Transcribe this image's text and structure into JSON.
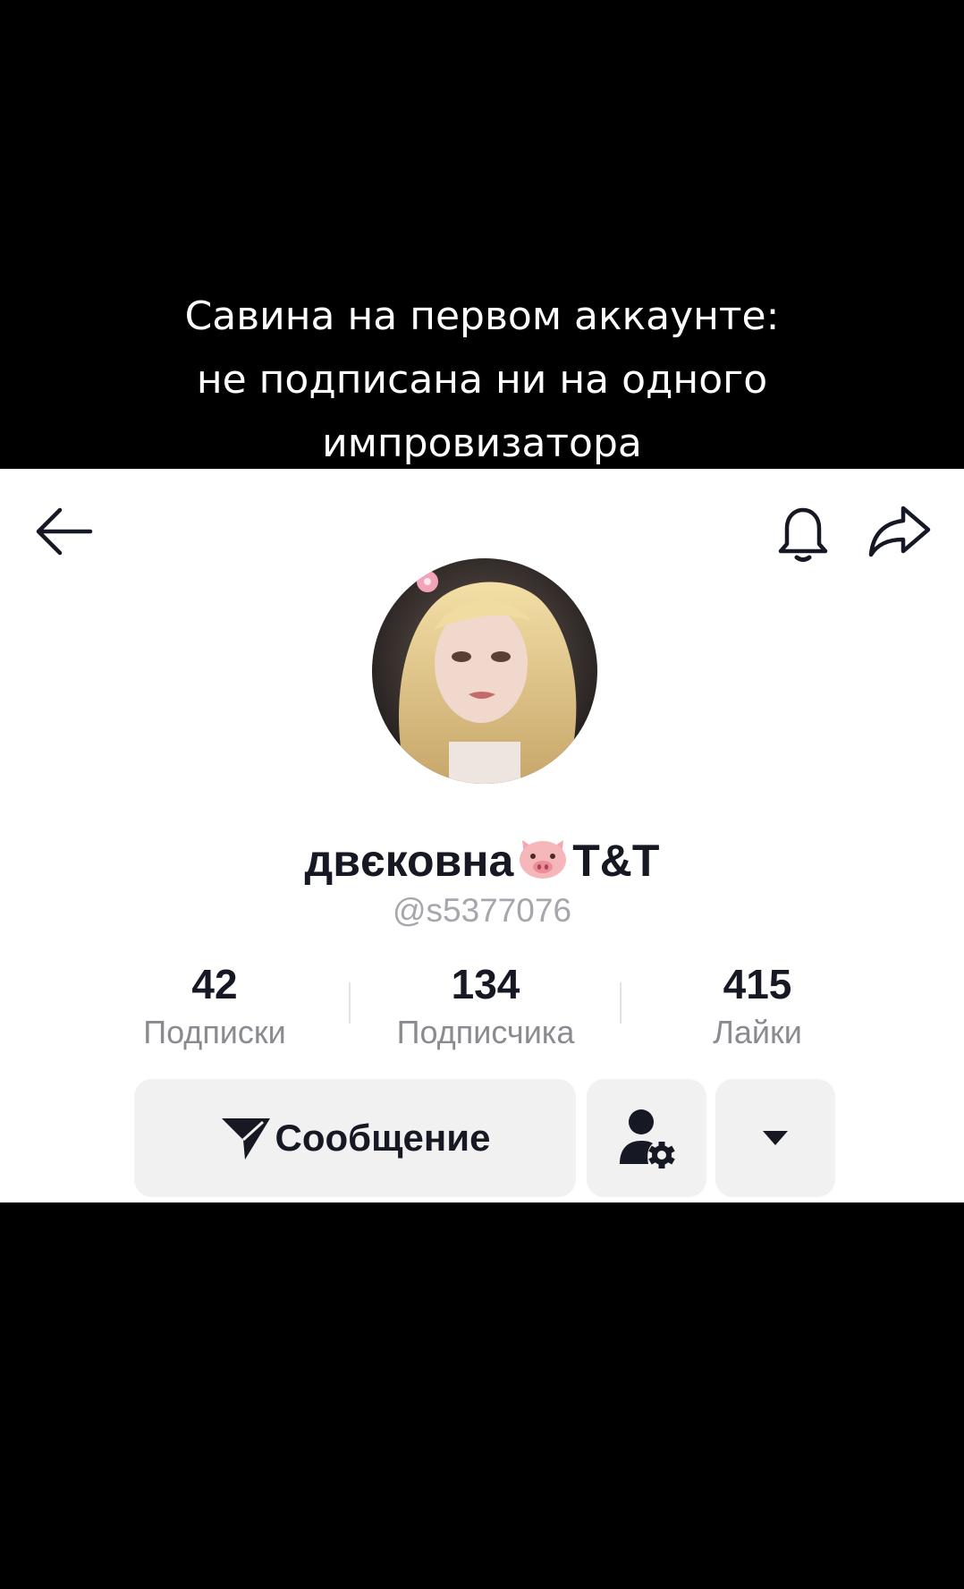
{
  "caption": {
    "line1": "Савина на первом аккаунте:",
    "line2": "не подписана ни на одного",
    "line3": "импровизатора"
  },
  "header": {
    "back_icon": "arrow-left-icon",
    "bell_icon": "bell-icon",
    "share_icon": "share-arrow-icon"
  },
  "profile": {
    "avatar": "avatar-photo",
    "display_name_part1": "двєковна",
    "display_name_emoji": "pig-face-emoji",
    "display_name_part2": "T&T",
    "username": "@s5377076"
  },
  "stats": [
    {
      "value": "42",
      "label": "Подписки"
    },
    {
      "value": "134",
      "label": "Подписчика"
    },
    {
      "value": "415",
      "label": "Лайки"
    }
  ],
  "actions": {
    "message_label": "Сообщение",
    "message_icon": "paper-plane-icon",
    "friends_icon": "person-gear-icon",
    "more_icon": "caret-down-icon"
  },
  "colors": {
    "text_primary": "#161823",
    "text_secondary": "#8a8b91",
    "button_bg": "#f1f1f2",
    "letterbox": "#000000"
  }
}
